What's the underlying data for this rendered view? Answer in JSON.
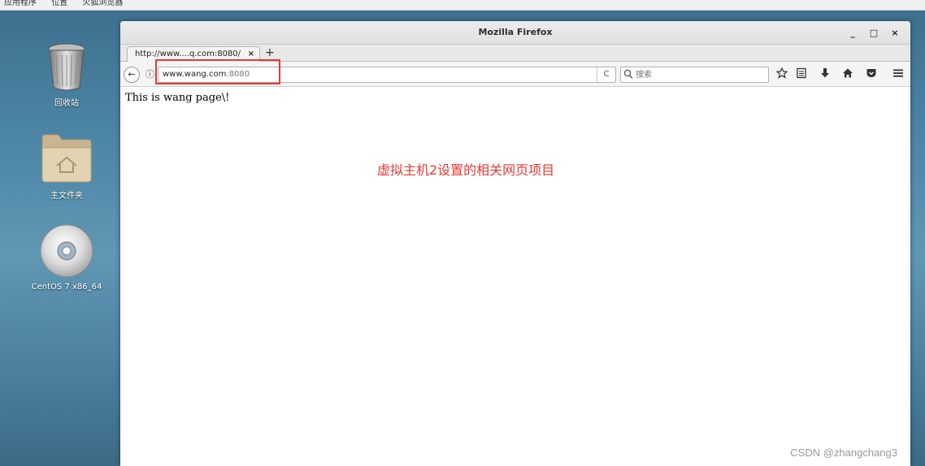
{
  "top_panel": {
    "applications": "应用程序",
    "places": "位置",
    "firefox": "火狐浏览器"
  },
  "desktop": {
    "icons": [
      {
        "label": "回收站",
        "icon": "trash-icon"
      },
      {
        "label": "主文件夹",
        "icon": "home-folder-icon"
      },
      {
        "label": "CentOS 7 x86_64",
        "icon": "disc-icon"
      }
    ]
  },
  "window": {
    "title": "Mozilla Firefox",
    "controls": {
      "minimize": "_",
      "maximize": "□",
      "close": "×"
    }
  },
  "tabs": [
    {
      "label": "http://www....q.com:8080/",
      "close": "×"
    }
  ],
  "new_tab": "+",
  "navbar": {
    "back": "←",
    "info": "ⓘ",
    "url_domain": "www.wang.com",
    "url_port": ":8080",
    "reload": "C",
    "search_placeholder": "搜索"
  },
  "page": {
    "body_text": "This is wang page\\!"
  },
  "annotation": "虚拟主机2设置的相关网页项目",
  "watermark": "CSDN @zhangchang3",
  "colors": {
    "annotation": "#e53935",
    "highlight_box": "#e53935"
  }
}
